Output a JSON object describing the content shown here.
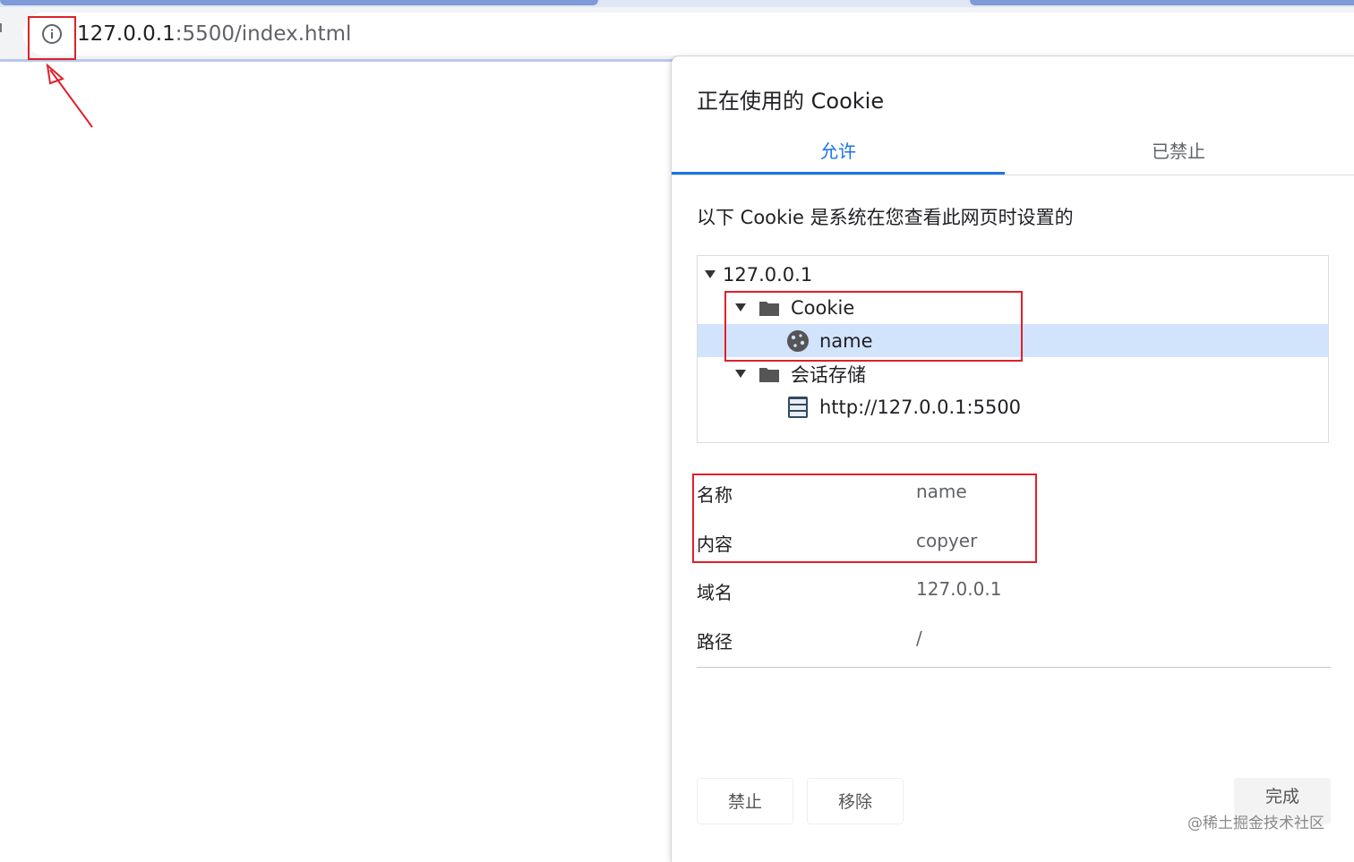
{
  "browser": {
    "address_bar": {
      "url_host": "127.0.0.1",
      "url_rest": ":5500/index.html",
      "site_info_icon": "info-circle-icon"
    }
  },
  "dialog": {
    "title": "正在使用的 Cookie",
    "tabs": [
      {
        "label": "允许",
        "active": true
      },
      {
        "label": "已禁止",
        "active": false
      }
    ],
    "description": "以下 Cookie 是系统在您查看此网页时设置的",
    "tree": [
      {
        "label": "127.0.0.1",
        "icon": "triangle-down-icon"
      },
      {
        "label": "Cookie",
        "icon": "folder-icon"
      },
      {
        "label": "name",
        "icon": "cookie-icon",
        "selected": true
      },
      {
        "label": "会话存储",
        "icon": "folder-icon"
      },
      {
        "label": "http://127.0.0.1:5500",
        "icon": "database-icon"
      }
    ],
    "details": [
      {
        "key": "名称",
        "value": "name"
      },
      {
        "key": "内容",
        "value": "copyer"
      },
      {
        "key": "域名",
        "value": "127.0.0.1"
      },
      {
        "key": "路径",
        "value": "/"
      }
    ],
    "buttons": {
      "block": "禁止",
      "remove": "移除",
      "done": "完成"
    }
  },
  "watermark": "@稀土掘金技术社区",
  "colors": {
    "accent": "#1a73e8",
    "selected_row": "#d2e3fc",
    "annotation_red": "#e0202a"
  }
}
